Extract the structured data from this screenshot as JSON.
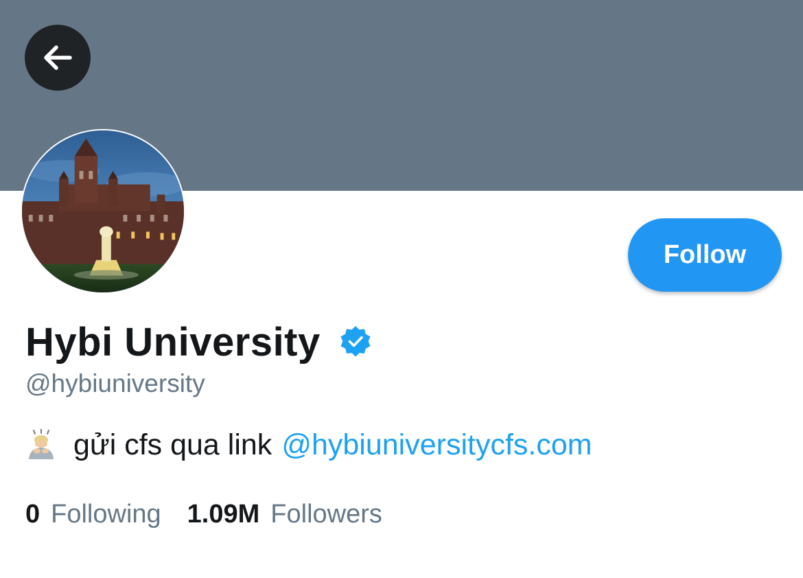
{
  "header": {
    "banner_color": "#657786",
    "back_icon": "arrow-left-icon"
  },
  "profile": {
    "avatar_description": "avatar-image",
    "follow_label": "Follow",
    "display_name": "Hybi University",
    "verified_icon": "verified-badge-icon",
    "handle": "@hybiuniversity",
    "bio": {
      "emoji_icon": "person-bowing-emoji-icon",
      "text": "gửi cfs qua link",
      "link": "@hybiuniversitycfs.com"
    },
    "stats": {
      "following_count": "0",
      "following_label": "Following",
      "followers_count": "1.09M",
      "followers_label": "Followers"
    }
  },
  "colors": {
    "accent": "#2196f3",
    "link": "#1da1f2",
    "secondary_text": "#657786",
    "primary_text": "#14171a"
  }
}
